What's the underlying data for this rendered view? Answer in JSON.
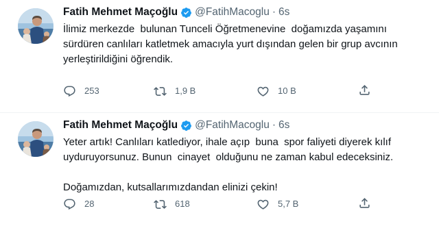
{
  "tweets": [
    {
      "author": "Fatih Mehmet Maçoğlu",
      "handle": "@FatihMacoglu",
      "separator": "·",
      "time": "6s",
      "lines": [
        "İlimiz merkezde  bulunan Tunceli Öğretmenevine  doğamızda yaşamını",
        "sürdüren canlıları katletmek amacıyla yurt dışından gelen bir grup avcının",
        "yerleştirildiğini öğrendik."
      ],
      "replies": "253",
      "retweets": "1,9 B",
      "likes": "10 B"
    },
    {
      "author": "Fatih Mehmet Maçoğlu",
      "handle": "@FatihMacoglu",
      "separator": "·",
      "time": "6s",
      "lines": [
        "Yeter artık! Canlıları katlediyor, ihale açıp  buna  spor faliyeti diyerek kılıf",
        "uyduruyorsunuz. Bunun  cinayet  olduğunu ne zaman kabul edeceksiniz.",
        "",
        "Doğamızdan, kutsallarımızdandan elinizi çekin!"
      ],
      "replies": "28",
      "retweets": "618",
      "likes": "5,7 B"
    }
  ],
  "icons": {
    "verified": "verified-badge-icon",
    "reply": "reply-icon",
    "retweet": "retweet-icon",
    "like": "heart-icon",
    "share": "share-icon"
  },
  "colors": {
    "verified": "#1d9bf0",
    "text": "#0f1419",
    "secondary": "#536471",
    "divider": "#eff3f4"
  }
}
